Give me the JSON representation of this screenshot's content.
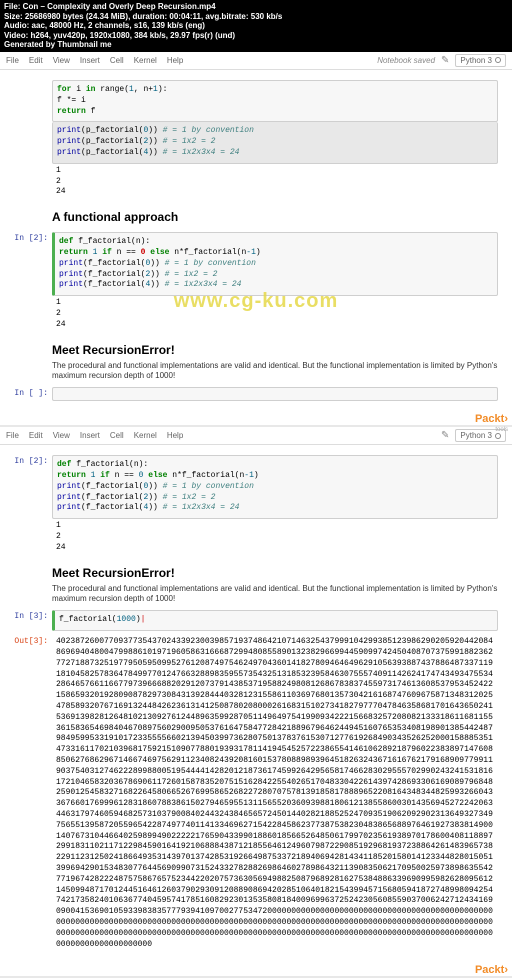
{
  "fileinfo": {
    "l1": "File: Con – Complexity and Overly Deep Recursion.mp4",
    "l2": "Size: 25686980 bytes (24.34 MiB), duration: 00:04:11, avg.bitrate: 530 kb/s",
    "l3": "Audio: aac, 48000 Hz, 2 channels, s16, 139 kb/s (eng)",
    "l4": "Video: h264, yuv420p, 1920x1080, 384 kb/s, 29.97 fps(r) (und)",
    "l5": "Generated by Thumbnail me"
  },
  "menu": {
    "file": "File",
    "edit": "Edit",
    "view": "View",
    "insert": "Insert",
    "cell": "Cell",
    "kernel": "Kernel",
    "help": "Help"
  },
  "saved": "Notebook saved",
  "python": "Python 3",
  "top": {
    "code_partial": {
      "ln1a": "for",
      "ln1b": " i ",
      "ln1c": "in",
      "ln1d": " range(",
      "ln1e": "1",
      "ln1f": ", n+",
      "ln1g": "1",
      "ln1h": "):",
      "ln2": "            f *= i",
      "ln3a": "return",
      "ln3b": " f"
    },
    "prints": {
      "p1": "print",
      "p1t": "(p_factorial(",
      "p1n": "0",
      "p1e": "))  ",
      "p1c": "# = 1 by convention",
      "p2": "print",
      "p2t": "(p_factorial(",
      "p2n": "2",
      "p2e": "))  ",
      "p2c": "# = 1x2 = 2",
      "p3": "print",
      "p3t": "(p_factorial(",
      "p3n": "4",
      "p3e": "))  ",
      "p3c": "# = 1x2x3x4 = 24"
    },
    "out": "1\n2\n24"
  },
  "funcHeading": "A functional approach",
  "cell2": {
    "prompt": "In [2]:",
    "d1a": "def",
    "d1b": " f_factorial(n):",
    "d2a": "return",
    "d2b": " 1 ",
    "d2c": "if",
    "d2d": " n == ",
    "d2cur": "0",
    "d2e": " ",
    "d2f": "else",
    "d2g": " n*f_factorial(n",
    "d2h": "-1",
    "d2i": ")",
    "p1": "print",
    "p1t": "(f_factorial(",
    "p1n": "0",
    "p1e": "))  ",
    "p1c": "# = 1 by convention",
    "p2": "print",
    "p2t": "(f_factorial(",
    "p2n": "2",
    "p2e": "))  ",
    "p2c": "# = 1x2 = 2",
    "p3": "print",
    "p3t": "(f_factorial(",
    "p3n": "4",
    "p3e": "))  ",
    "p3c": "# = 1x2x3x4 = 24",
    "out": "1\n2\n24"
  },
  "recHeading": "Meet RecursionError!",
  "recP": "The procedural and functional implementations are valid and identical. But the functional implementation is limited by Python's maximum recursion depth of 1000!",
  "emptyPrompt": "In [ ]:",
  "cell3": {
    "prompt": "In [3]:",
    "outPrompt": "Out[3]:",
    "call_a": "f_factorial(",
    "call_n": "1000",
    "call_b": ")",
    "big": "402387260077093773543702433923003985719374864210714632543799910429938512398629020592044208486969404800479988610197196058631666872994808558901323829669944590997424504087073759918823627727188732519779505950995276120874975462497043601418278094646496291056393887437886487337119181045825783647849977012476632889835955735432513185323958463075557409114262417474349347553428646576611667797396668820291207379143853719588249808126867838374559731746136085379534524221586593201928090878297308431392844403281231558611036976801357304216168747609675871348312025478589320767169132448426236131412508780208000261683151027341827977704784635868170164365024153691398281264810213092761244896359928705114964975419909342221566832572080821333186116811553615836546984046708975602900950537616475847728421889679646244945160765353408198901385442487984959953319101723355556602139450399736280750137837615307127761926849034352625200015888535147331611702103968175921510907788019393178114194545257223865541461062892187960223838971476088506276862967146674697562911234082439208160153780889893964518263243671616762179168909779911903754031274622289988005195444414282012187361745992642956581746628302955570299024324153181617210465832036786906117260158783520751516284225540265170483304226143974286933061690897968482590125458327168226458066526769958652682272807075781391858178889652208164348344825993266043367660176999612831860788386150279465955131156552036093988180612138558600301435694527224206344631797460594682573103790084024432438465657245014402821885252470935190620929023136493273497565513958720559654228749774011413346962715422845862377387538230483865688976461927383814900140767310446640259899490222221765904339901886018566526485061799702356193897017860040811889729918311021171229845901641921068884387121855646124960798722908519296819372388642614839657382291123125024186649353143970137428531926649875337218940694281434118520158014123344828015051399694290153483077644569099073152433278288269864602789864321139083506217095002597389863554277196742822248757586765752344220207573630569498825087968928162753848863396909959826280956121450994871701244516461260379029309120889086942028510640182154399457156805941872748998094254742173582401063677404595741785160829230135358081840096996372524230560855903700624271243416909004153690105933983835777939410970027753472000000000000000000000000000000000000000000000000000000000000000000000000000000000000000000000000000000000000000000000000000000000000000000000000000000000000000000000000000000000000000000000000000000000000000000000000000000000000000000000000000000000"
  },
  "watermark": "www.cg-ku.com",
  "packt": "Packt›",
  "toc2": "tools"
}
